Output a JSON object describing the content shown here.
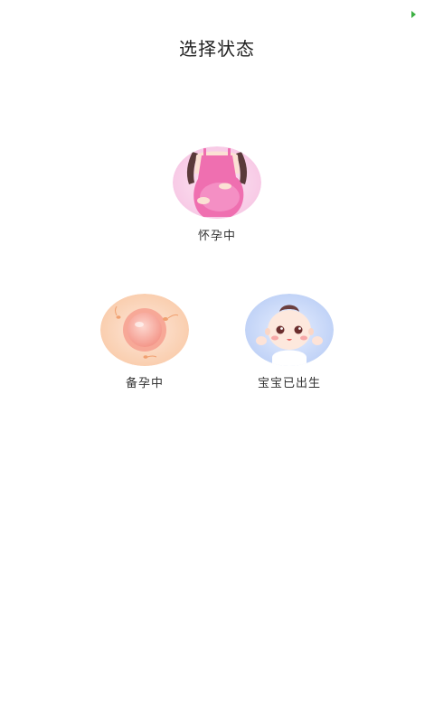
{
  "header": {
    "title": "选择状态"
  },
  "options": [
    {
      "key": "pregnant",
      "label": "怀孕中",
      "icon": "pregnant-woman-icon",
      "accent": "#f48fc4"
    },
    {
      "key": "preparing",
      "label": "备孕中",
      "icon": "egg-cell-icon",
      "accent": "#f7b48c"
    },
    {
      "key": "born",
      "label": "宝宝已出生",
      "icon": "baby-face-icon",
      "accent": "#b9cdf5"
    }
  ],
  "colors": {
    "status_indicator": "#3cb043",
    "title_text": "#222222",
    "label_text": "#333333"
  }
}
